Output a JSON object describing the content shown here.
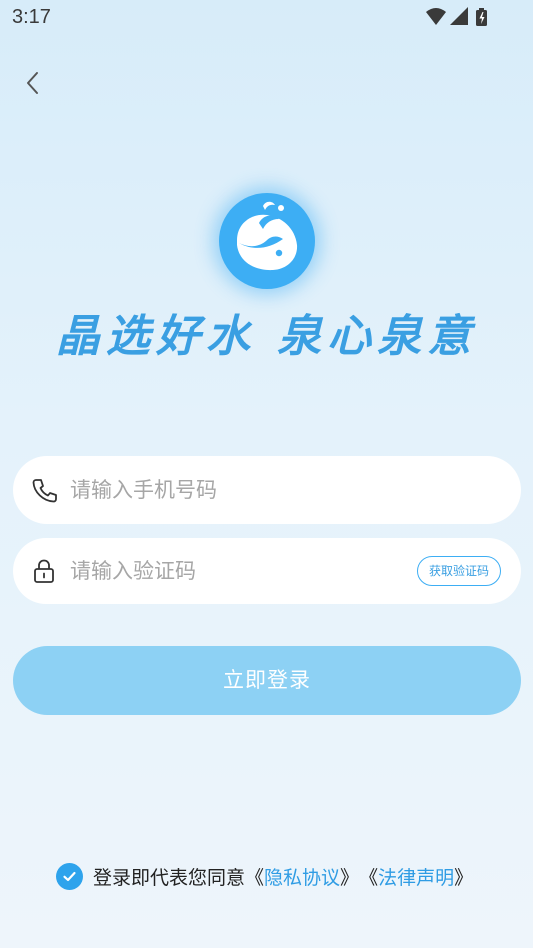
{
  "status_bar": {
    "time": "3:17"
  },
  "icons": {
    "back": "chevron-left-icon",
    "wifi": "wifi-icon",
    "signal": "signal-icon",
    "battery": "battery-charging-icon",
    "logo": "whale-logo-icon",
    "phone": "phone-icon",
    "lock": "lock-icon",
    "check": "check-icon"
  },
  "brand": {
    "slogan": "晶选好水 泉心泉意"
  },
  "form": {
    "phone_placeholder": "请输入手机号码",
    "code_placeholder": "请输入验证码",
    "get_code_label": "获取验证码",
    "login_label": "立即登录"
  },
  "agreement": {
    "checked": true,
    "prefix": "登录即代表您同意",
    "open_quote_1": "《",
    "privacy_link": "隐私协议",
    "close_quote_1": "》",
    "open_quote_2": "《",
    "legal_link": "法律声明",
    "close_quote_2": "》"
  },
  "colors": {
    "accent": "#3daef4",
    "link": "#2f9ce4",
    "login_button": "#8dd1f4",
    "background_top": "#d7ecf9",
    "background_bottom": "#eef5fb"
  }
}
